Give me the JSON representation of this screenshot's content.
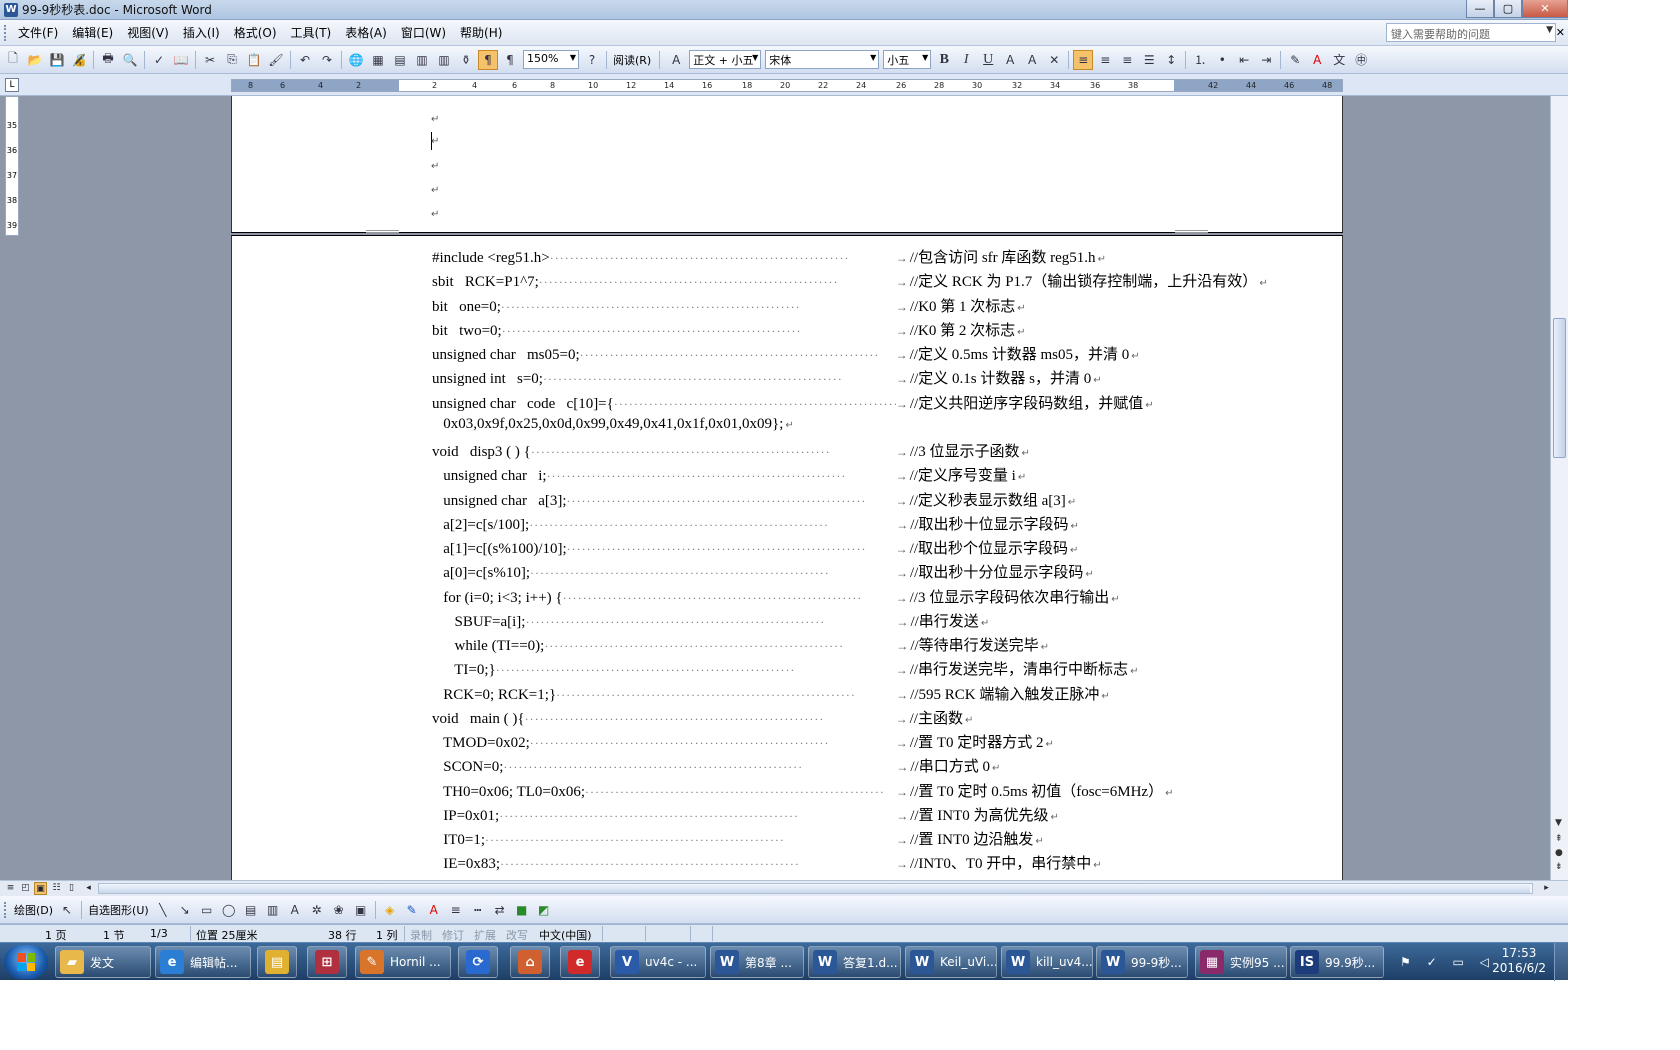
{
  "window": {
    "title": "99-9秒秒表.doc - Microsoft Word",
    "min": "—",
    "max": "▢",
    "close": "✕"
  },
  "menu": {
    "items": [
      "文件(F)",
      "编辑(E)",
      "视图(V)",
      "插入(I)",
      "格式(O)",
      "工具(T)",
      "表格(A)",
      "窗口(W)",
      "帮助(H)"
    ],
    "help_placeholder": "键入需要帮助的问题",
    "close_doc": "✕"
  },
  "toolbar": {
    "zoom": "150%",
    "read_label": "阅读(R)",
    "style": "正文 + 小五",
    "font": "宋体",
    "size": "小五",
    "bold": "B",
    "italic": "I",
    "underline": "U"
  },
  "ruler": {
    "ticks": [
      "8",
      "6",
      "4",
      "2",
      "2",
      "4",
      "6",
      "8",
      "10",
      "12",
      "14",
      "16",
      "18",
      "20",
      "22",
      "24",
      "26",
      "28",
      "30",
      "32",
      "34",
      "36",
      "38",
      "42",
      "44",
      "46",
      "48"
    ],
    "vticks": [
      "35",
      "36",
      "37",
      "38",
      "39"
    ]
  },
  "document": {
    "paragraph_mark": "↵",
    "tab_arrow": "→",
    "code_lines": [
      {
        "code": "#include <reg51.h>",
        "comment": "//包含访问 sfr 库函数 reg51.h"
      },
      {
        "code": "sbit   RCK=P1^7;",
        "comment": "//定义 RCK 为 P1.7（输出锁存控制端，上升沿有效）"
      },
      {
        "code": "bit   one=0;",
        "comment": "//K0 第 1 次标志"
      },
      {
        "code": "bit   two=0;",
        "comment": "//K0 第 2 次标志"
      },
      {
        "code": "unsigned char   ms05=0;",
        "comment": "//定义 0.5ms 计数器 ms05，并清 0"
      },
      {
        "code": "unsigned int   s=0;",
        "comment": "//定义 0.1s 计数器 s，并清 0"
      },
      {
        "code": "unsigned char   code   c[10]={",
        "comment": "//定义共阳逆序字段码数组，并赋值"
      },
      {
        "code": "   0x03,0x9f,0x25,0x0d,0x99,0x49,0x41,0x1f,0x01,0x09};",
        "comment": ""
      },
      {
        "code": "void   disp3 ( ) {",
        "comment": "//3 位显示子函数"
      },
      {
        "code": "   unsigned char   i;",
        "comment": "//定义序号变量 i"
      },
      {
        "code": "   unsigned char   a[3];",
        "comment": "//定义秒表显示数组 a[3]"
      },
      {
        "code": "   a[2]=c[s/100];",
        "comment": "//取出秒十位显示字段码"
      },
      {
        "code": "   a[1]=c[(s%100)/10];",
        "comment": "//取出秒个位显示字段码"
      },
      {
        "code": "   a[0]=c[s%10];",
        "comment": "//取出秒十分位显示字段码"
      },
      {
        "code": "   for (i=0; i<3; i++) {",
        "comment": "//3 位显示字段码依次串行输出"
      },
      {
        "code": "      SBUF=a[i];",
        "comment": "//串行发送"
      },
      {
        "code": "      while (TI==0);",
        "comment": "//等待串行发送完毕"
      },
      {
        "code": "      TI=0;}",
        "comment": "//串行发送完毕，清串行中断标志"
      },
      {
        "code": "   RCK=0; RCK=1;}",
        "comment": "//595 RCK 端输入触发正脉冲"
      },
      {
        "code": "void   main ( ){",
        "comment": "//主函数"
      },
      {
        "code": "   TMOD=0x02;",
        "comment": "//置 T0 定时器方式 2"
      },
      {
        "code": "   SCON=0;",
        "comment": "//串口方式 0"
      },
      {
        "code": "   TH0=0x06; TL0=0x06;",
        "comment": "//置 T0 定时 0.5ms 初值（fosc=6MHz）"
      },
      {
        "code": "   IP=0x01;",
        "comment": "//置 INT0 为高优先级"
      },
      {
        "code": "   IT0=1;",
        "comment": "//置 INT0 边沿触发"
      },
      {
        "code": "   IE=0x83;",
        "comment": "//INT0、T0 开中，串行禁中"
      }
    ]
  },
  "drawbar": {
    "draw": "绘图(D)",
    "autoshape": "自选图形(U)"
  },
  "status": {
    "page": "1 页",
    "section": "1 节",
    "pages": "1/3",
    "position": "位置  25厘米",
    "line": "38 行",
    "col": "1 列",
    "rec": "录制",
    "trk": "修订",
    "ext": "扩展",
    "ovr": "改写",
    "lang": "中文(中国)"
  },
  "taskbar": {
    "items": [
      {
        "label": "发文",
        "icon": "folder-icon",
        "color": "#e8b84a"
      },
      {
        "label": "编辑帖...",
        "icon": "ie-icon",
        "color": "#2a7fd4"
      },
      {
        "label": "Hornil ...",
        "icon": "pencil-icon",
        "color": "#d9752a"
      },
      {
        "label": "uv4c  - ...",
        "icon": "keil-icon",
        "color": "#2a5aa8"
      },
      {
        "label": "第8章 ...",
        "icon": "word-icon",
        "color": "#2b5797"
      },
      {
        "label": "答复1.d...",
        "icon": "word-icon",
        "color": "#2b5797"
      },
      {
        "label": "Keil_uVi...",
        "icon": "word-icon",
        "color": "#2b5797"
      },
      {
        "label": "kill_uv4...",
        "icon": "word-icon",
        "color": "#2b5797"
      },
      {
        "label": "99-9秒...",
        "icon": "word-icon",
        "color": "#2b5797"
      },
      {
        "label": "实例95 ...",
        "icon": "winrar-icon",
        "color": "#8a2a6a"
      },
      {
        "label": "99.9秒...",
        "icon": "isis-icon",
        "color": "#1c3c7c"
      }
    ],
    "time": "17:53",
    "date": "2016/6/2"
  }
}
